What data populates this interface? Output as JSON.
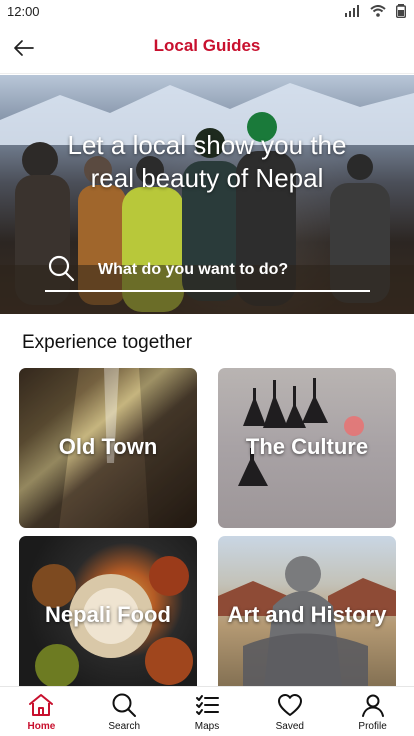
{
  "status_bar": {
    "time": "12:00"
  },
  "header": {
    "title": "Local Guides"
  },
  "hero": {
    "title_line1": "Let a local show you the",
    "title_line2": "real beauty of Nepal",
    "search_placeholder": "What do you want to do?"
  },
  "section": {
    "title": "Experience together"
  },
  "cards": [
    {
      "label": "Old Town"
    },
    {
      "label": "The Culture"
    },
    {
      "label": "Nepali Food"
    },
    {
      "label": "Art and History"
    }
  ],
  "tabs": [
    {
      "label": "Home",
      "icon": "home-icon",
      "active": true
    },
    {
      "label": "Search",
      "icon": "search-icon"
    },
    {
      "label": "Maps",
      "icon": "list-icon"
    },
    {
      "label": "Saved",
      "icon": "heart-icon"
    },
    {
      "label": "Profile",
      "icon": "user-icon"
    }
  ],
  "colors": {
    "accent": "#c8102e"
  }
}
